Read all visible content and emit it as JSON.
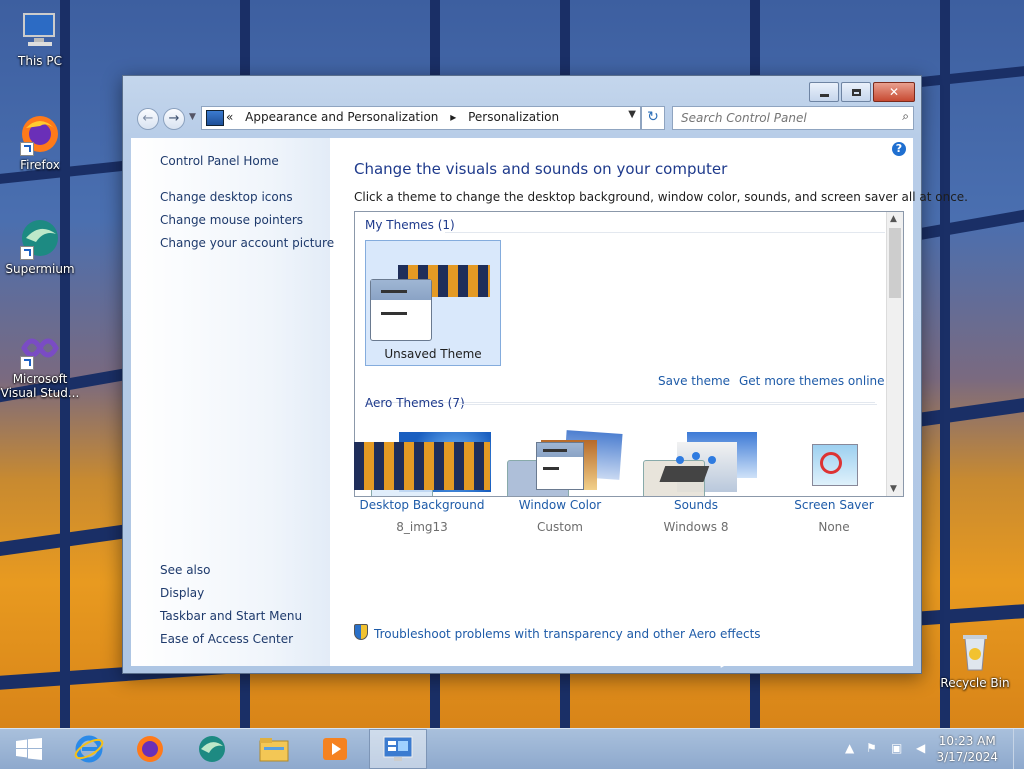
{
  "desktop": {
    "icons": [
      {
        "label": "This PC"
      },
      {
        "label": "Firefox"
      },
      {
        "label": "Supermium"
      },
      {
        "label": "Microsoft Visual Stud..."
      },
      {
        "label": "Recycle Bin"
      }
    ]
  },
  "window": {
    "address": {
      "prefix": "«",
      "crumbs": [
        "Appearance and Personalization",
        "Personalization"
      ]
    },
    "search": {
      "placeholder": "Search Control Panel"
    },
    "left_pane": {
      "home": "Control Panel Home",
      "tasks": [
        "Change desktop icons",
        "Change mouse pointers",
        "Change your account picture"
      ],
      "see_also_title": "See also",
      "see_also": [
        "Display",
        "Taskbar and Start Menu",
        "Ease of Access Center"
      ]
    },
    "main": {
      "heading": "Change the visuals and sounds on your computer",
      "description": "Click a theme to change the desktop background, window color, sounds, and screen saver all at once.",
      "my_themes_title": "My Themes (1)",
      "unsaved_theme": "Unsaved Theme",
      "save_theme": "Save theme",
      "get_more": "Get more themes online",
      "aero_themes_title": "Aero Themes (7)",
      "settings": [
        {
          "name": "Desktop Background",
          "value": "8_img13"
        },
        {
          "name": "Window Color",
          "value": "Custom"
        },
        {
          "name": "Sounds",
          "value": "Windows 8"
        },
        {
          "name": "Screen Saver",
          "value": "None"
        }
      ],
      "troubleshoot": "Troubleshoot problems with transparency and other Aero effects"
    }
  },
  "taskbar": {
    "time": "10:23 AM",
    "date": "3/17/2024"
  }
}
